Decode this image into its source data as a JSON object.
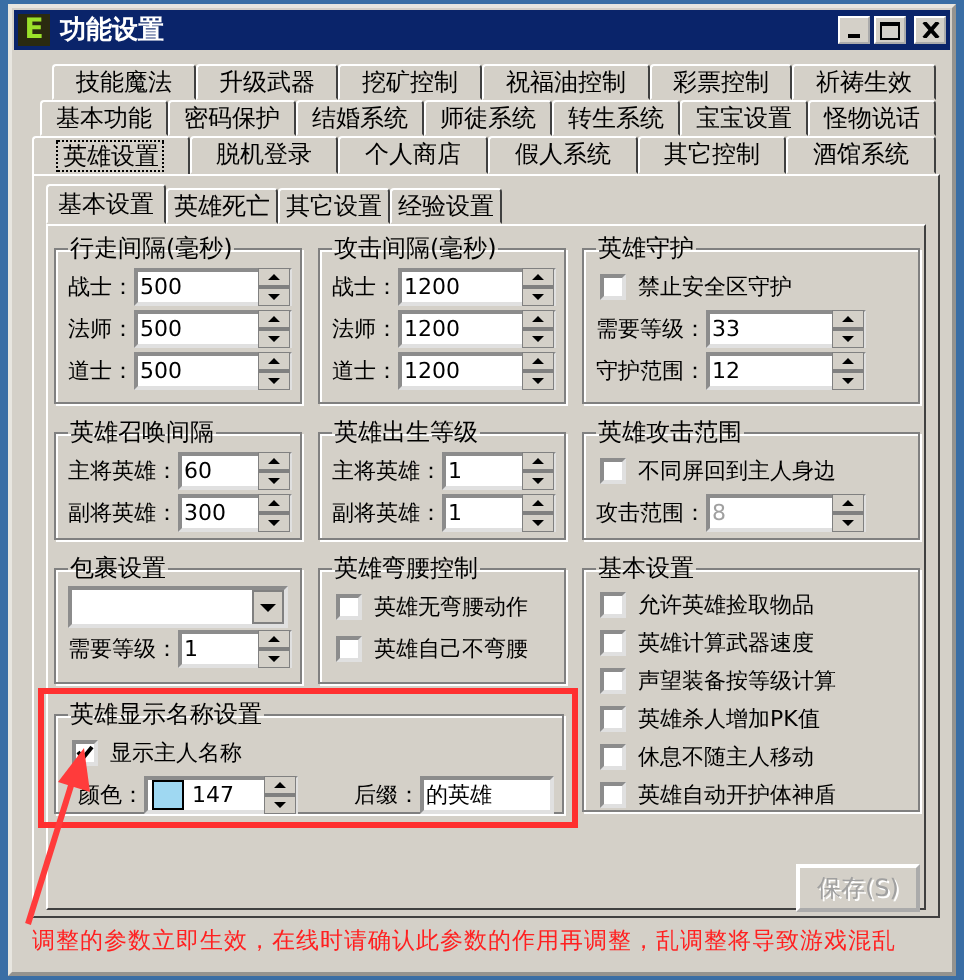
{
  "window": {
    "icon_letter": "E",
    "title": "功能设置"
  },
  "tab_rows": [
    [
      {
        "label": "技能魔法",
        "selected": false
      },
      {
        "label": "升级武器",
        "selected": false
      },
      {
        "label": "挖矿控制",
        "selected": false
      },
      {
        "label": "祝福油控制",
        "selected": false
      },
      {
        "label": "彩票控制",
        "selected": false
      },
      {
        "label": "祈祷生效",
        "selected": false
      }
    ],
    [
      {
        "label": "基本功能",
        "selected": false
      },
      {
        "label": "密码保护",
        "selected": false
      },
      {
        "label": "结婚系统",
        "selected": false
      },
      {
        "label": "师徒系统",
        "selected": false
      },
      {
        "label": "转生系统",
        "selected": false
      },
      {
        "label": "宝宝设置",
        "selected": false
      },
      {
        "label": "怪物说话",
        "selected": false
      }
    ],
    [
      {
        "label": "英雄设置",
        "selected": true
      },
      {
        "label": "脱机登录",
        "selected": false
      },
      {
        "label": "个人商店",
        "selected": false
      },
      {
        "label": "假人系统",
        "selected": false
      },
      {
        "label": "其它控制",
        "selected": false
      },
      {
        "label": "酒馆系统",
        "selected": false
      }
    ]
  ],
  "sub_tabs": [
    {
      "label": "基本设置",
      "selected": true
    },
    {
      "label": "英雄死亡",
      "selected": false
    },
    {
      "label": "其它设置",
      "selected": false
    },
    {
      "label": "经验设置",
      "selected": false
    }
  ],
  "left_groups": [
    {
      "title": "行走间隔(毫秒)",
      "items": [
        {
          "kind": "spin",
          "label": "战士：",
          "value": "500",
          "disabled": false
        },
        {
          "kind": "spin",
          "label": "法师：",
          "value": "500",
          "disabled": false
        },
        {
          "kind": "spin",
          "label": "道士：",
          "value": "500",
          "disabled": false
        }
      ]
    },
    {
      "title": "攻击间隔(毫秒)",
      "items": [
        {
          "kind": "spin",
          "label": "战士：",
          "value": "1200",
          "disabled": false
        },
        {
          "kind": "spin",
          "label": "法师：",
          "value": "1200",
          "disabled": false
        },
        {
          "kind": "spin",
          "label": "道士：",
          "value": "1200",
          "disabled": false
        }
      ]
    },
    {
      "title": "英雄召唤间隔",
      "items": [
        {
          "kind": "spin",
          "label": "主将英雄：",
          "value": "60",
          "disabled": false
        },
        {
          "kind": "spin",
          "label": "副将英雄：",
          "value": "300",
          "disabled": false
        }
      ]
    },
    {
      "title": "英雄出生等级",
      "items": [
        {
          "kind": "spin",
          "label": "主将英雄：",
          "value": "1",
          "disabled": false
        },
        {
          "kind": "spin",
          "label": "副将英雄：",
          "value": "1",
          "disabled": false
        }
      ]
    },
    {
      "title": "包裹设置",
      "items": [
        {
          "kind": "combo"
        },
        {
          "kind": "spin",
          "label": "需要等级：",
          "value": "1",
          "disabled": false
        }
      ]
    },
    {
      "title": "英雄弯腰控制",
      "items": [
        {
          "kind": "check",
          "label": "英雄无弯腰动作",
          "checked": false
        },
        {
          "kind": "check",
          "label": "英雄自己不弯腰",
          "checked": false
        }
      ]
    },
    {
      "title": "英雄显示名称设置",
      "items": [
        {
          "kind": "check",
          "label": "显示主人名称",
          "checked": true
        },
        {
          "kind": "pair",
          "fields": [
            {
              "kind": "color",
              "label": "颜色：",
              "value": "147",
              "color": "#9fd8f2"
            },
            {
              "kind": "text",
              "label": "后缀：",
              "value": "的英雄"
            }
          ]
        }
      ]
    }
  ],
  "right_groups": [
    {
      "title": "英雄守护",
      "items": [
        {
          "kind": "check",
          "label": "禁止安全区守护",
          "checked": false
        },
        {
          "kind": "spin",
          "label": "需要等级：",
          "value": "33",
          "disabled": false
        },
        {
          "kind": "spin",
          "label": "守护范围：",
          "value": "12",
          "disabled": false
        }
      ]
    },
    {
      "title": "英雄攻击范围",
      "items": [
        {
          "kind": "check",
          "label": "不同屏回到主人身边",
          "checked": false
        },
        {
          "kind": "spin",
          "label": "攻击范围：",
          "value": "8",
          "disabled": true
        }
      ]
    },
    {
      "title": "基本设置",
      "items": [
        {
          "kind": "check",
          "label": "允许英雄捡取物品",
          "checked": false
        },
        {
          "kind": "check",
          "label": "英雄计算武器速度",
          "checked": false
        },
        {
          "kind": "check",
          "label": "声望装备按等级计算",
          "checked": false
        },
        {
          "kind": "check",
          "label": "英雄杀人增加PK值",
          "checked": false
        },
        {
          "kind": "check",
          "label": "休息不随主人移动",
          "checked": false
        },
        {
          "kind": "check",
          "label": "英雄自动开护体神盾",
          "checked": false
        }
      ]
    }
  ],
  "save_button": {
    "label": "保存(S)",
    "disabled": true
  },
  "note": "调整的参数立即生效，在线时请确认此参数的作用再调整，乱调整将导致游戏混乱"
}
